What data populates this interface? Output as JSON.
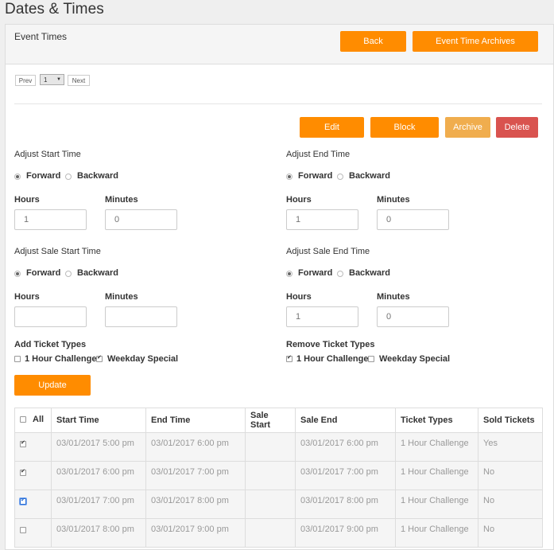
{
  "page_title": "Dates & Times",
  "panel": {
    "title": "Event Times",
    "back_label": "Back",
    "archives_label": "Event Time Archives"
  },
  "pager": {
    "prev": "Prev",
    "page": "1",
    "next": "Next"
  },
  "actions": {
    "edit": "Edit",
    "block": "Block",
    "archive": "Archive",
    "delete": "Delete"
  },
  "adjust_start": {
    "title": "Adjust Start Time",
    "forward": "Forward",
    "backward": "Backward",
    "hours_label": "Hours",
    "minutes_label": "Minutes",
    "hours_placeholder": "1",
    "minutes_placeholder": "0"
  },
  "adjust_end": {
    "title": "Adjust End Time",
    "forward": "Forward",
    "backward": "Backward",
    "hours_label": "Hours",
    "minutes_label": "Minutes",
    "hours_placeholder": "1",
    "minutes_placeholder": "0"
  },
  "adjust_sale_start": {
    "title": "Adjust Sale Start Time",
    "forward": "Forward",
    "backward": "Backward",
    "hours_label": "Hours",
    "minutes_label": "Minutes",
    "hours_placeholder": "",
    "minutes_placeholder": ""
  },
  "adjust_sale_end": {
    "title": "Adjust Sale End Time",
    "forward": "Forward",
    "backward": "Backward",
    "hours_label": "Hours",
    "minutes_label": "Minutes",
    "hours_placeholder": "1",
    "minutes_placeholder": "0"
  },
  "add_ticket_types": {
    "title": "Add Ticket Types",
    "opt1": "1 Hour Challenge",
    "opt2": "Weekday Special"
  },
  "remove_ticket_types": {
    "title": "Remove Ticket Types",
    "opt1": "1 Hour Challenge",
    "opt2": "Weekday Special"
  },
  "update_label": "Update",
  "table": {
    "headers": [
      "All",
      "Start Time",
      "End Time",
      "Sale Start",
      "Sale End",
      "Ticket Types",
      "Sold Tickets"
    ],
    "rows": [
      {
        "start": "03/01/2017 5:00 pm",
        "end": "03/01/2017 6:00 pm",
        "sale_start": "",
        "sale_end": "03/01/2017 6:00 pm",
        "types": "1 Hour Challenge",
        "sold": "Yes"
      },
      {
        "start": "03/01/2017 6:00 pm",
        "end": "03/01/2017 7:00 pm",
        "sale_start": "",
        "sale_end": "03/01/2017 7:00 pm",
        "types": "1 Hour Challenge",
        "sold": "No"
      },
      {
        "start": "03/01/2017 7:00 pm",
        "end": "03/01/2017 8:00 pm",
        "sale_start": "",
        "sale_end": "03/01/2017 8:00 pm",
        "types": "1 Hour Challenge",
        "sold": "No"
      },
      {
        "start": "03/01/2017 8:00 pm",
        "end": "03/01/2017 9:00 pm",
        "sale_start": "",
        "sale_end": "03/01/2017 9:00 pm",
        "types": "1 Hour Challenge",
        "sold": "No"
      }
    ]
  },
  "colors": {
    "primary": "#ff8c00",
    "archive": "#f0ad4e",
    "delete": "#d9534f"
  }
}
